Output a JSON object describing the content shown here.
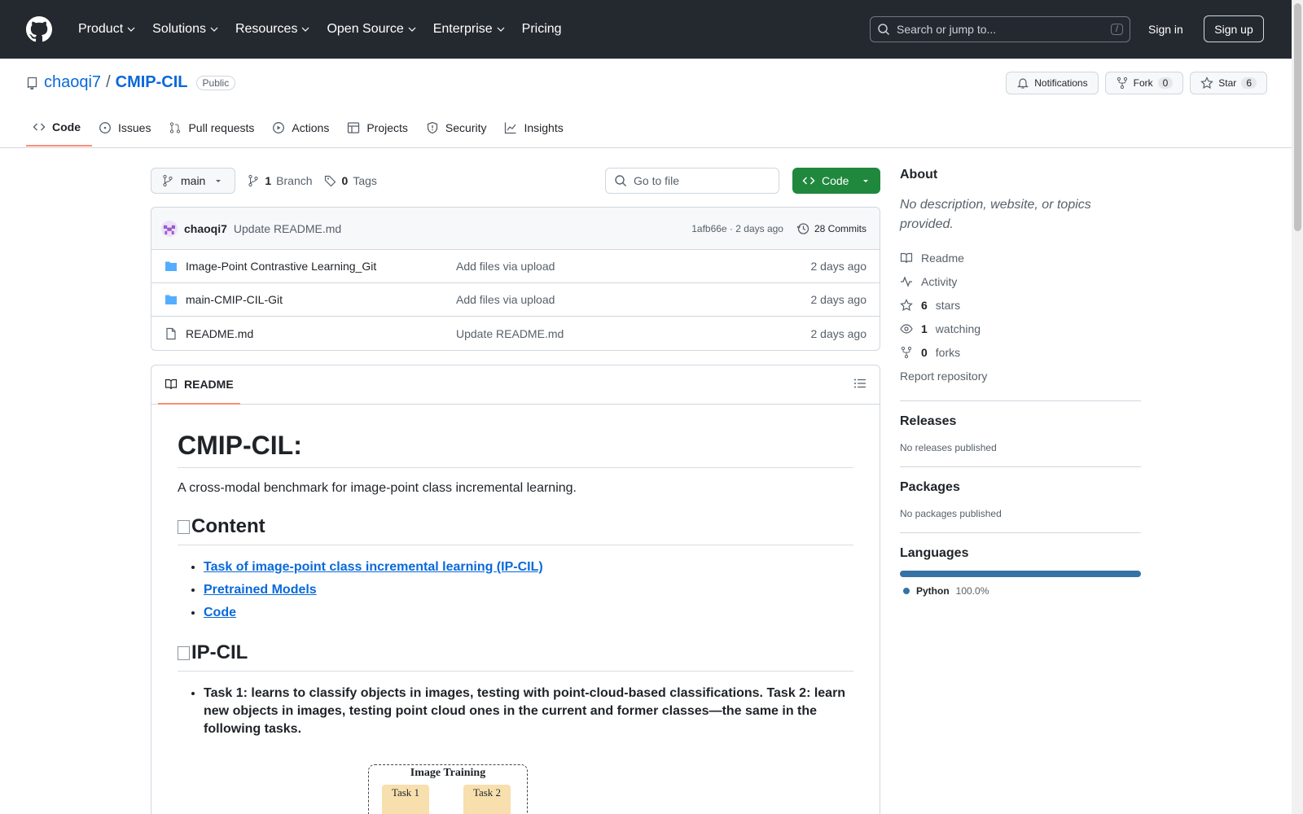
{
  "header": {
    "nav": [
      "Product",
      "Solutions",
      "Resources",
      "Open Source",
      "Enterprise",
      "Pricing"
    ],
    "search_placeholder": "Search or jump to...",
    "search_shortcut": "/",
    "sign_in": "Sign in",
    "sign_up": "Sign up"
  },
  "repo": {
    "owner": "chaoqi7",
    "separator": "/",
    "name": "CMIP-CIL",
    "visibility": "Public",
    "notifications_label": "Notifications",
    "fork_label": "Fork",
    "fork_count": "0",
    "star_label": "Star",
    "star_count": "6",
    "tabs": [
      "Code",
      "Issues",
      "Pull requests",
      "Actions",
      "Projects",
      "Security",
      "Insights"
    ]
  },
  "toolbar": {
    "branch": "main",
    "branch_count": "1",
    "branch_label": "Branch",
    "tag_count": "0",
    "tag_label": "Tags",
    "goto_placeholder": "Go to file",
    "code_button": "Code"
  },
  "commit": {
    "author": "chaoqi7",
    "message": "Update README.md",
    "sha_time": "1afb66e · 2 days ago",
    "count_label": "28 Commits"
  },
  "files": [
    {
      "name": "Image-Point Contrastive Learning_Git",
      "type": "folder",
      "message": "Add files via upload",
      "date": "2 days ago"
    },
    {
      "name": "main-CMIP-CIL-Git",
      "type": "folder",
      "message": "Add files via upload",
      "date": "2 days ago"
    },
    {
      "name": "README.md",
      "type": "file",
      "message": "Update README.md",
      "date": "2 days ago"
    }
  ],
  "readme": {
    "tab_label": "README",
    "h1": "CMIP-CIL:",
    "intro": "A cross-modal benchmark for image-point class incremental learning.",
    "content_heading": "Content",
    "content_links": [
      "Task of image-point class incremental learning (IP-CIL)",
      "Pretrained Models",
      "Code"
    ],
    "ipcil_heading": "IP-CIL",
    "ipcil_text": "Task 1: learns to classify objects in images, testing with point-cloud-based classifications. Task 2: learn new objects in images, testing point cloud ones in the current and former classes—the same in the following tasks.",
    "figure_title": "Image Training",
    "figure_task1": "Task 1",
    "figure_task2": "Task 2"
  },
  "sidebar": {
    "about_heading": "About",
    "description": "No description, website, or topics provided.",
    "readme": "Readme",
    "activity": "Activity",
    "stars_count": "6",
    "stars_label": "stars",
    "watching_count": "1",
    "watching_label": "watching",
    "forks_count": "0",
    "forks_label": "forks",
    "report": "Report repository",
    "releases_heading": "Releases",
    "releases_text": "No releases published",
    "packages_heading": "Packages",
    "packages_text": "No packages published",
    "languages_heading": "Languages",
    "language_name": "Python",
    "language_pct": "100.0%",
    "language_color": "#3572a5"
  }
}
